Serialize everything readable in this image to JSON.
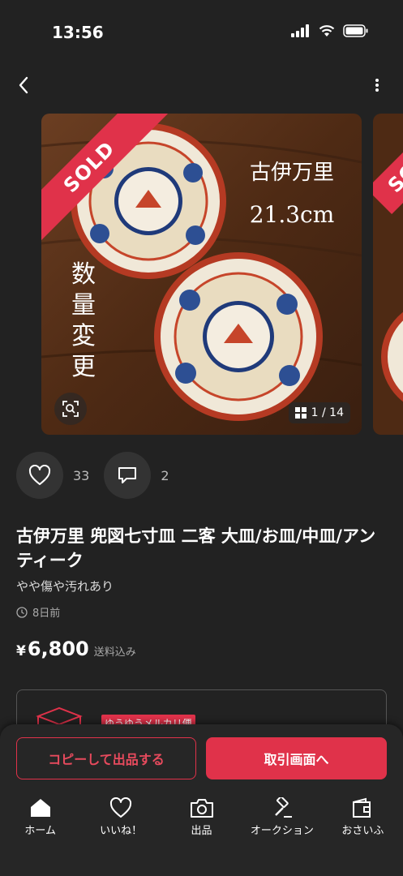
{
  "status_bar": {
    "time": "13:56"
  },
  "listing": {
    "images": {
      "sold_label": "SOLD",
      "overlay_title": "古伊万里",
      "overlay_size": "21.3cm",
      "overlay_vertical": "数量変更",
      "counter": "1 / 14"
    },
    "likes_count": "33",
    "comments_count": "2",
    "title": "古伊万里 兜図七寸皿 二客 大皿/お皿/中皿/アンティーク",
    "condition": "やや傷や汚れあり",
    "posted": "8日前",
    "price_symbol": "¥",
    "price": "6,800",
    "shipping_note": "送料込み",
    "shipping_method": "ゆうゆうメルカリ便"
  },
  "actions": {
    "copy_label": "コピーして出品する",
    "trade_label": "取引画面へ"
  },
  "tabbar": {
    "items": [
      {
        "label": "ホーム",
        "icon": "home-icon"
      },
      {
        "label": "いいね！",
        "icon": "heart-icon"
      },
      {
        "label": "出品",
        "icon": "camera-icon"
      },
      {
        "label": "オークション",
        "icon": "gavel-icon"
      },
      {
        "label": "おさいふ",
        "icon": "wallet-icon"
      }
    ]
  },
  "colors": {
    "accent": "#e0324a",
    "background": "#222222"
  }
}
